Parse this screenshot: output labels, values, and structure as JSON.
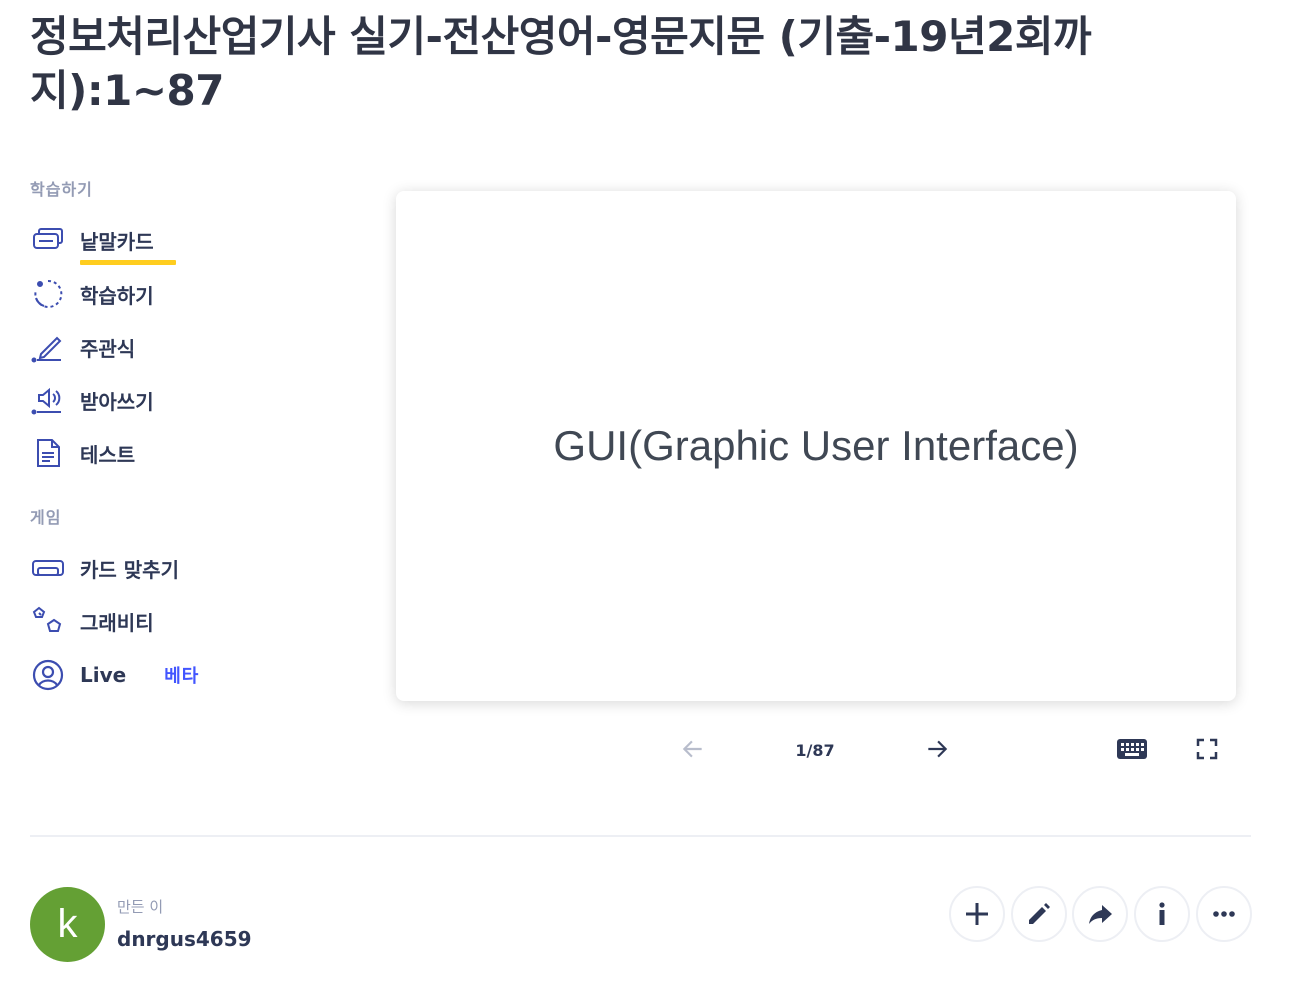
{
  "set_title": "정보처리산업기사 실기-전산영어-영문지문 (기출-19년2회까지):1~87",
  "sidebar": {
    "study_section_label": "학습하기",
    "study_items": [
      {
        "label": "낱말카드",
        "icon": "flashcards-icon",
        "active": true
      },
      {
        "label": "학습하기",
        "icon": "learn-icon"
      },
      {
        "label": "주관식",
        "icon": "write-icon"
      },
      {
        "label": "받아쓰기",
        "icon": "spell-icon"
      },
      {
        "label": "테스트",
        "icon": "test-icon"
      }
    ],
    "game_section_label": "게임",
    "game_items": [
      {
        "label": "카드 맞추기",
        "icon": "match-icon"
      },
      {
        "label": "그래비티",
        "icon": "gravity-icon"
      },
      {
        "label": "Live",
        "icon": "live-icon",
        "badge": "베타"
      }
    ]
  },
  "flashcard": {
    "term": "GUI(Graphic User Interface)"
  },
  "controls": {
    "counter": "1/87",
    "prev_icon": "arrow-left-icon",
    "next_icon": "arrow-right-icon",
    "keyboard_icon": "keyboard-icon",
    "fullscreen_icon": "fullscreen-icon"
  },
  "creator": {
    "caption": "만든 이",
    "avatar_letter": "k",
    "avatar_color": "#64a034",
    "username": "dnrgus4659"
  },
  "actions": [
    {
      "name": "add",
      "icon": "plus-icon"
    },
    {
      "name": "edit",
      "icon": "pencil-icon"
    },
    {
      "name": "share",
      "icon": "share-icon"
    },
    {
      "name": "info",
      "icon": "info-icon"
    },
    {
      "name": "more",
      "icon": "more-icon"
    }
  ],
  "colors": {
    "accent": "#4255ff",
    "active_underline": "#ffcd1f",
    "icon_stroke": "#3c4db0",
    "text_primary": "#2e3856"
  }
}
